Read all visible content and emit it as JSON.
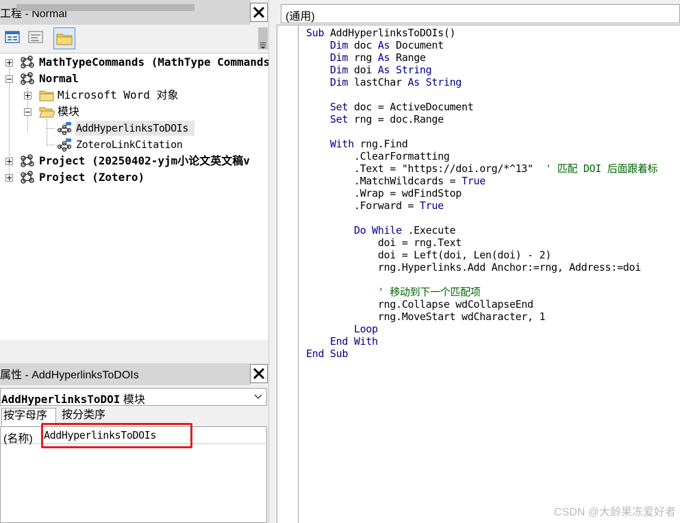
{
  "project_explorer": {
    "title": "工程 - Normal",
    "toolbar": {
      "view_object": "view-object-icon",
      "view_code": "view-code-icon",
      "toggle_folders": "folder-icon"
    },
    "tree": {
      "mathtype": "MathTypeCommands (MathType Commands",
      "normal": "Normal",
      "ms_word_objects": "Microsoft Word 对象",
      "modules": "模块",
      "module_add": "AddHyperlinksToDOIs",
      "module_zotero": "ZoteroLinkCitation",
      "project_paper": "Project (20250402-yjm小论文英文稿v",
      "project_zotero": "Project (Zotero)"
    }
  },
  "properties": {
    "title": "属性 - AddHyperlinksToDOIs",
    "selected_object_name": "AddHyperlinksToDOI",
    "selected_object_type": " 模块",
    "tab_alphabetic": "按字母序",
    "tab_categorized": "按分类序",
    "name_key": "(名称)",
    "name_value": "AddHyperlinksToDOIs"
  },
  "code_window": {
    "object_dropdown": "(通用)",
    "lines": [
      [
        {
          "t": "Sub ",
          "c": "kw"
        },
        {
          "t": "AddHyperlinksToDOIs()",
          "c": ""
        }
      ],
      [
        {
          "t": "    Dim ",
          "c": "kw"
        },
        {
          "t": "doc ",
          "c": ""
        },
        {
          "t": "As ",
          "c": "kw"
        },
        {
          "t": "Document",
          "c": ""
        }
      ],
      [
        {
          "t": "    Dim ",
          "c": "kw"
        },
        {
          "t": "rng ",
          "c": ""
        },
        {
          "t": "As ",
          "c": "kw"
        },
        {
          "t": "Range",
          "c": ""
        }
      ],
      [
        {
          "t": "    Dim ",
          "c": "kw"
        },
        {
          "t": "doi ",
          "c": ""
        },
        {
          "t": "As ",
          "c": "kw"
        },
        {
          "t": "String",
          "c": "kw"
        }
      ],
      [
        {
          "t": "    Dim ",
          "c": "kw"
        },
        {
          "t": "lastChar ",
          "c": ""
        },
        {
          "t": "As ",
          "c": "kw"
        },
        {
          "t": "String",
          "c": "kw"
        }
      ],
      [],
      [
        {
          "t": "    Set ",
          "c": "kw"
        },
        {
          "t": "doc = ActiveDocument",
          "c": ""
        }
      ],
      [
        {
          "t": "    Set ",
          "c": "kw"
        },
        {
          "t": "rng = doc.Range",
          "c": ""
        }
      ],
      [],
      [
        {
          "t": "    With ",
          "c": "kw"
        },
        {
          "t": "rng.Find",
          "c": ""
        }
      ],
      [
        {
          "t": "        .ClearFormatting",
          "c": ""
        }
      ],
      [
        {
          "t": "        .Text = \"https://doi.org/*^13\"  ",
          "c": ""
        },
        {
          "t": "' 匹配 DOI 后面跟着标",
          "c": "cm"
        }
      ],
      [
        {
          "t": "        .MatchWildcards = ",
          "c": ""
        },
        {
          "t": "True",
          "c": "kw"
        }
      ],
      [
        {
          "t": "        .Wrap = wdFindStop",
          "c": ""
        }
      ],
      [
        {
          "t": "        .Forward = ",
          "c": ""
        },
        {
          "t": "True",
          "c": "kw"
        }
      ],
      [],
      [
        {
          "t": "        Do While ",
          "c": "kw"
        },
        {
          "t": ".Execute",
          "c": ""
        }
      ],
      [
        {
          "t": "            doi = rng.Text",
          "c": ""
        }
      ],
      [
        {
          "t": "            doi = Left(doi, Len(doi) - 2)",
          "c": ""
        }
      ],
      [
        {
          "t": "            rng.Hyperlinks.Add Anchor:=rng, Address:=doi",
          "c": ""
        }
      ],
      [],
      [
        {
          "t": "            ' 移动到下一个匹配项",
          "c": "cm"
        }
      ],
      [
        {
          "t": "            rng.Collapse wdCollapseEnd",
          "c": ""
        }
      ],
      [
        {
          "t": "            rng.MoveStart wdCharacter, 1",
          "c": ""
        }
      ],
      [
        {
          "t": "        Loop",
          "c": "kw"
        }
      ],
      [
        {
          "t": "    End With",
          "c": "kw"
        }
      ],
      [
        {
          "t": "End Sub",
          "c": "kw"
        }
      ]
    ]
  },
  "watermark": "CSDN @大龄果冻爱好者",
  "colors": {
    "keyword": "#00008b",
    "comment": "#006400",
    "highlight": "#e01e1e",
    "title_bar": "#d6d6d6"
  }
}
